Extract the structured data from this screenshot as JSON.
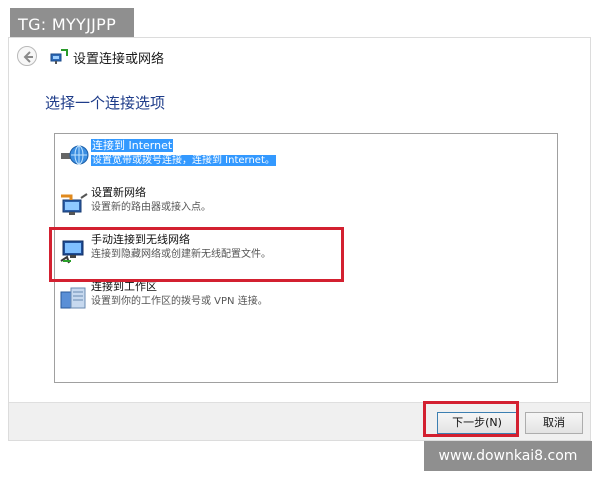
{
  "badge": {
    "text": "TG: MYYJJPP"
  },
  "window": {
    "title": "设置连接或网络"
  },
  "main": {
    "heading": "选择一个连接选项"
  },
  "options": [
    {
      "title": "连接到 Internet",
      "desc": "设置宽带或拨号连接，连接到 Internet。",
      "icon": "globe-icon",
      "selected": true
    },
    {
      "title": "设置新网络",
      "desc": "设置新的路由器或接入点。",
      "icon": "router-setup-icon",
      "selected": false
    },
    {
      "title": "手动连接到无线网络",
      "desc": "连接到隐藏网络或创建新无线配置文件。",
      "icon": "wireless-monitor-icon",
      "selected": false
    },
    {
      "title": "连接到工作区",
      "desc": "设置到你的工作区的拨号或 VPN 连接。",
      "icon": "workplace-icon",
      "selected": false
    }
  ],
  "footer": {
    "next_label": "下一步(N)",
    "cancel_label": "取消"
  },
  "watermark": {
    "text": "www.downkai8.com"
  },
  "colors": {
    "accent": "#3399ff",
    "heading": "#1f3d8a",
    "highlight": "#d32030"
  }
}
